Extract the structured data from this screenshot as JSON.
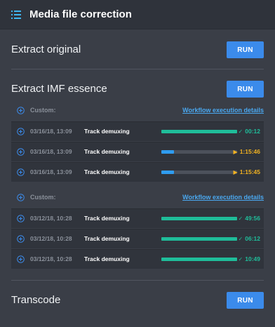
{
  "header": {
    "title": "Media file correction",
    "icon": "list-icon"
  },
  "sections": [
    {
      "label": "Extract original",
      "button": "RUN"
    },
    {
      "label": "Extract IMF essence",
      "button": "RUN"
    },
    {
      "label": "Transcode",
      "button": "RUN"
    }
  ],
  "groups": [
    {
      "custom_label": "Custom:",
      "link": "Workflow execution details",
      "rows": [
        {
          "date": "03/16/18, 13:09",
          "name": "Track demuxing",
          "progress": 1.0,
          "status": "done",
          "time": "00:12"
        },
        {
          "date": "03/16/18, 13:09",
          "name": "Track demuxing",
          "progress": 0.17,
          "status": "running",
          "time": "1:15:46"
        },
        {
          "date": "03/16/18, 13:09",
          "name": "Track demuxing",
          "progress": 0.17,
          "status": "running",
          "time": "1:15:45"
        }
      ]
    },
    {
      "custom_label": "Custom:",
      "link": "Workflow execution details",
      "rows": [
        {
          "date": "03/12/18, 10:28",
          "name": "Track demuxing",
          "progress": 1.0,
          "status": "done",
          "time": "49:56"
        },
        {
          "date": "03/12/18, 10:28",
          "name": "Track demuxing",
          "progress": 1.0,
          "status": "done",
          "time": "06:12"
        },
        {
          "date": "03/12/18, 10:28",
          "name": "Track demuxing",
          "progress": 1.0,
          "status": "done",
          "time": "10:49"
        }
      ]
    }
  ],
  "colors": {
    "accent": "#3b8beb",
    "done": "#1fbd9a",
    "running_bar": "#2f9cf0",
    "running_status": "#f2b221",
    "link": "#4aa8f0"
  }
}
